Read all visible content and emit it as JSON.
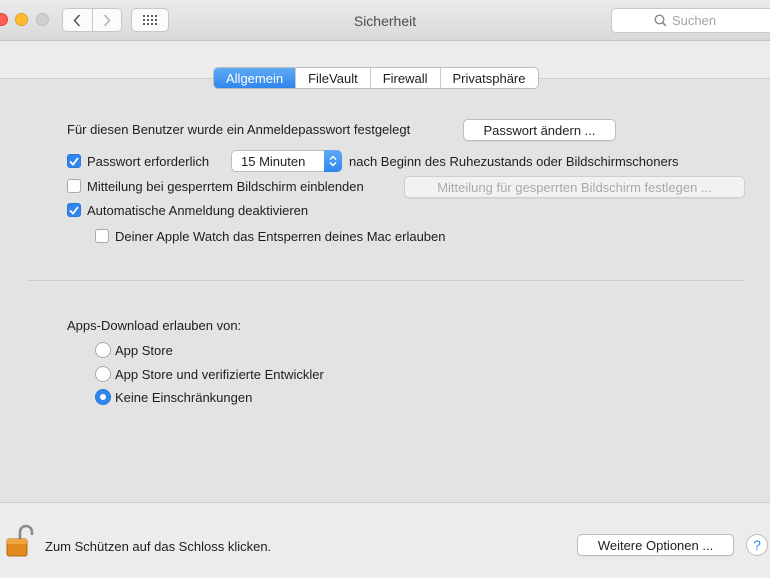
{
  "window": {
    "title": "Sicherheit",
    "search_placeholder": "Suchen"
  },
  "tabs": [
    {
      "label": "Allgemein",
      "active": true
    },
    {
      "label": "FileVault",
      "active": false
    },
    {
      "label": "Firewall",
      "active": false
    },
    {
      "label": "Privatsphäre",
      "active": false
    }
  ],
  "general": {
    "password_set_text": "Für diesen Benutzer wurde ein Anmeldepasswort festgelegt",
    "change_password_button": "Passwort ändern ...",
    "require_password": {
      "label": "Passwort erforderlich",
      "checked": true
    },
    "require_password_delay": "15 Minuten",
    "require_password_suffix": "nach Beginn des Ruhezustands oder Bildschirmschoners",
    "lock_message": {
      "label": "Mitteilung bei gesperrtem Bildschirm einblenden",
      "checked": false
    },
    "lock_message_button": "Mitteilung für gesperrten Bildschirm festlegen ...",
    "disable_auto_login": {
      "label": "Automatische Anmeldung deaktivieren",
      "checked": true
    },
    "apple_watch_unlock": {
      "label": "Deiner Apple Watch das Entsperren deines Mac erlauben",
      "checked": false
    }
  },
  "downloads": {
    "heading": "Apps-Download erlauben von:",
    "options": [
      {
        "label": "App Store",
        "selected": false
      },
      {
        "label": "App Store und verifizierte Entwickler",
        "selected": false
      },
      {
        "label": "Keine Einschränkungen",
        "selected": true
      }
    ]
  },
  "footer": {
    "lock_text": "Zum Schützen auf das Schloss klicken.",
    "advanced_button": "Weitere Optionen ...",
    "help_label": "?"
  },
  "colors": {
    "accent": "#2f86ee",
    "close": "#fd5f57",
    "minimize": "#febc2e",
    "lock_body": "#e08a1e"
  }
}
